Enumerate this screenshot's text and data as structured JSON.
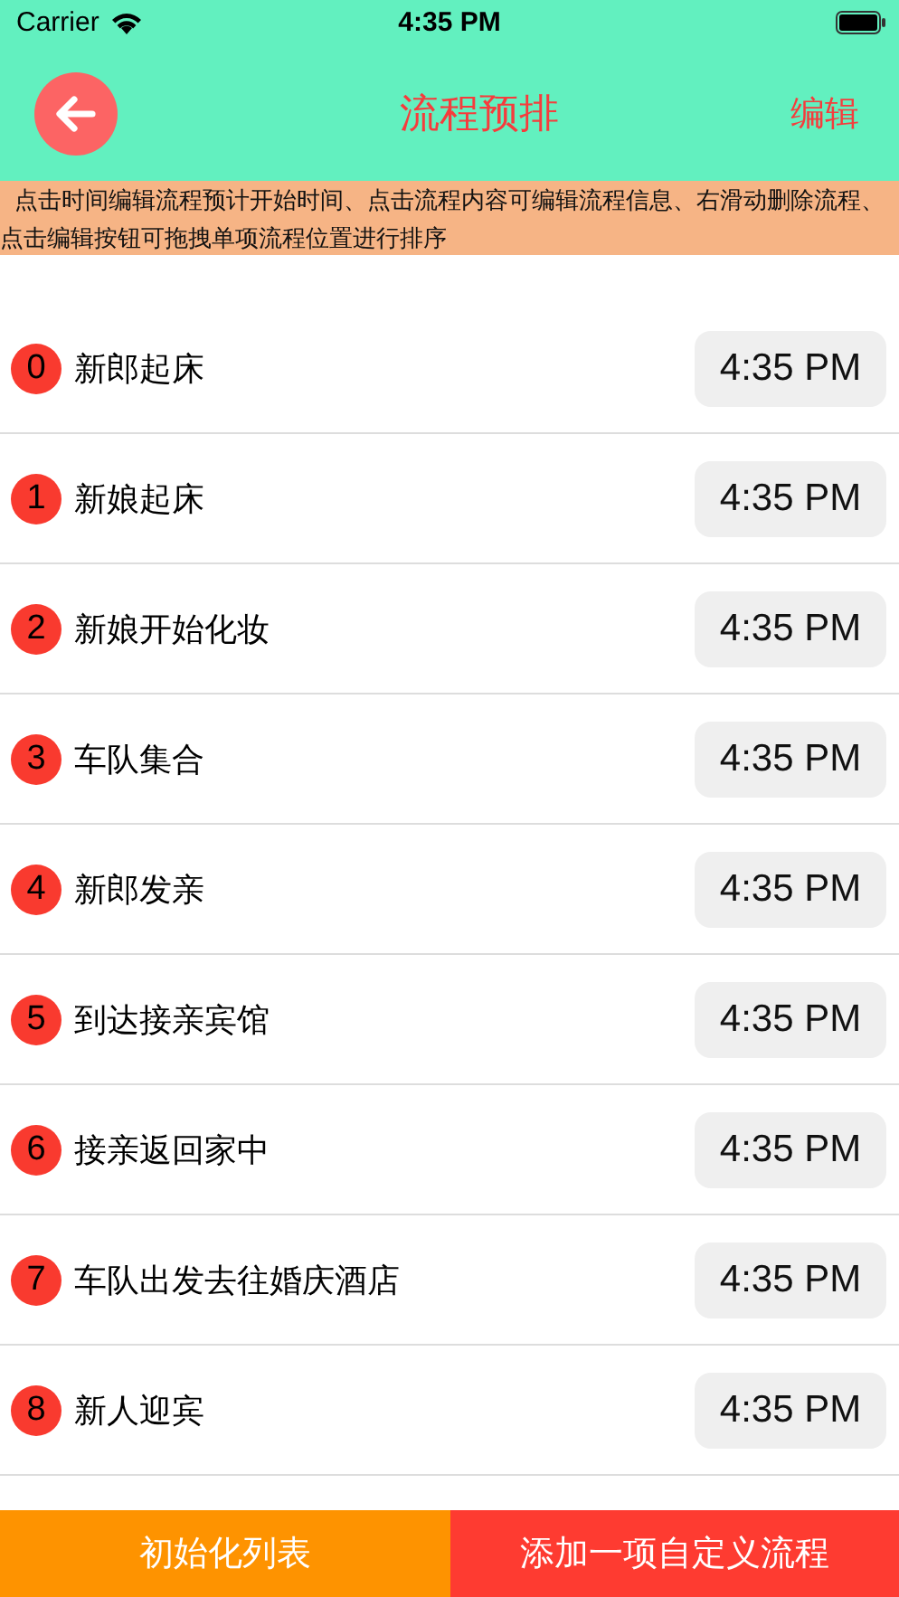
{
  "status_bar": {
    "carrier": "Carrier",
    "time": "4:35 PM"
  },
  "nav_bar": {
    "title": "流程预排",
    "edit": "编辑"
  },
  "hint": "点击时间编辑流程预计开始时间、点击流程内容可编辑流程信息、右滑动删除流程、点击编辑按钮可拖拽单项流程位置进行排序",
  "steps": [
    {
      "index": "0",
      "name": "新郎起床",
      "time": "4:35 PM"
    },
    {
      "index": "1",
      "name": "新娘起床",
      "time": "4:35 PM"
    },
    {
      "index": "2",
      "name": "新娘开始化妆",
      "time": "4:35 PM"
    },
    {
      "index": "3",
      "name": "车队集合",
      "time": "4:35 PM"
    },
    {
      "index": "4",
      "name": "新郎发亲",
      "time": "4:35 PM"
    },
    {
      "index": "5",
      "name": "到达接亲宾馆",
      "time": "4:35 PM"
    },
    {
      "index": "6",
      "name": "接亲返回家中",
      "time": "4:35 PM"
    },
    {
      "index": "7",
      "name": "车队出发去往婚庆酒店",
      "time": "4:35 PM"
    },
    {
      "index": "8",
      "name": "新人迎宾",
      "time": "4:35 PM"
    }
  ],
  "buttons": [
    {
      "kind": "reset",
      "label": "初始化列表"
    },
    {
      "kind": "add",
      "label": "添加一项自定义流程"
    }
  ]
}
